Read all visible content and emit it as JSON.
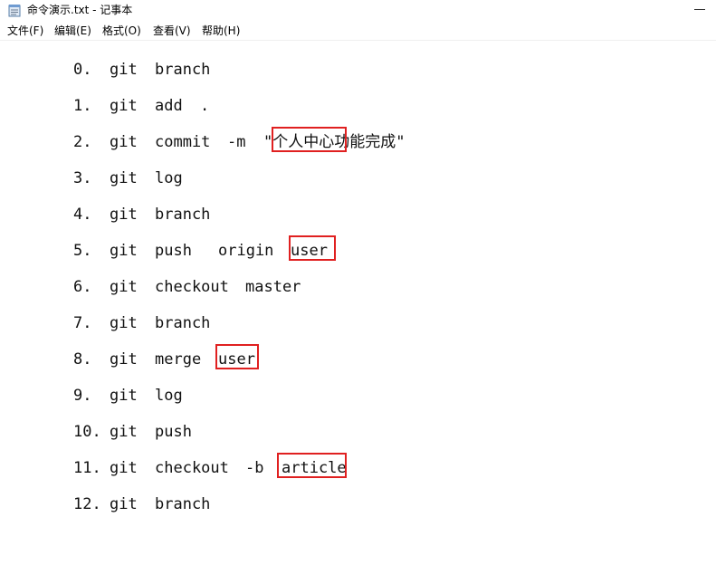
{
  "window": {
    "title": "命令演示.txt - 记事本",
    "icon": "notepad-icon"
  },
  "menu": {
    "items": [
      {
        "label": "文件(F)"
      },
      {
        "label": "编辑(E)"
      },
      {
        "label": "格式(O)"
      },
      {
        "label": "查看(V)"
      },
      {
        "label": "帮助(H)"
      }
    ]
  },
  "document": {
    "lines": [
      {
        "num": "0.",
        "cmd": "git",
        "args": [
          "branch"
        ]
      },
      {
        "num": "1.",
        "cmd": "git",
        "args": [
          "add",
          "."
        ]
      },
      {
        "num": "2.",
        "cmd": "git",
        "args": [
          "commit",
          "-m",
          "\"个人中心功能完成\""
        ]
      },
      {
        "num": "3.",
        "cmd": "git",
        "args": [
          "log"
        ]
      },
      {
        "num": "4.",
        "cmd": "git",
        "args": [
          "branch"
        ]
      },
      {
        "num": "5.",
        "cmd": "git",
        "args": [
          "push",
          "origin",
          "user"
        ]
      },
      {
        "num": "6.",
        "cmd": "git",
        "args": [
          "checkout",
          "master"
        ]
      },
      {
        "num": "7.",
        "cmd": "git",
        "args": [
          "branch"
        ]
      },
      {
        "num": "8.",
        "cmd": "git",
        "args": [
          "merge",
          "user"
        ]
      },
      {
        "num": "9.",
        "cmd": "git",
        "args": [
          "log"
        ]
      },
      {
        "num": "10.",
        "cmd": "git",
        "args": [
          "push"
        ]
      },
      {
        "num": "11.",
        "cmd": "git",
        "args": [
          "checkout",
          "-b",
          "article"
        ]
      },
      {
        "num": "12.",
        "cmd": "git",
        "args": [
          "branch"
        ]
      }
    ]
  },
  "colors": {
    "highlight_border": "#e02020",
    "text": "#111111"
  }
}
